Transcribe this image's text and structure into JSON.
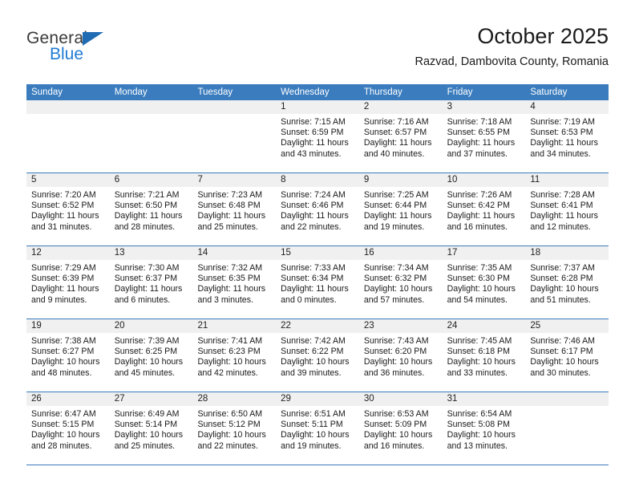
{
  "branding": {
    "name_top": "General",
    "name_bottom": "Blue",
    "accent_color": "#1f7bd4",
    "header_color": "#3a7cbe"
  },
  "header": {
    "title": "October 2025",
    "subtitle": "Razvad, Dambovita County, Romania"
  },
  "calendar": {
    "weekday_headers": [
      "Sunday",
      "Monday",
      "Tuesday",
      "Wednesday",
      "Thursday",
      "Friday",
      "Saturday"
    ],
    "weeks": [
      [
        {
          "day": "",
          "empty": true
        },
        {
          "day": "",
          "empty": true
        },
        {
          "day": "",
          "empty": true
        },
        {
          "day": "1",
          "sunrise": "Sunrise: 7:15 AM",
          "sunset": "Sunset: 6:59 PM",
          "daylight_l1": "Daylight: 11 hours",
          "daylight_l2": "and 43 minutes."
        },
        {
          "day": "2",
          "sunrise": "Sunrise: 7:16 AM",
          "sunset": "Sunset: 6:57 PM",
          "daylight_l1": "Daylight: 11 hours",
          "daylight_l2": "and 40 minutes."
        },
        {
          "day": "3",
          "sunrise": "Sunrise: 7:18 AM",
          "sunset": "Sunset: 6:55 PM",
          "daylight_l1": "Daylight: 11 hours",
          "daylight_l2": "and 37 minutes."
        },
        {
          "day": "4",
          "sunrise": "Sunrise: 7:19 AM",
          "sunset": "Sunset: 6:53 PM",
          "daylight_l1": "Daylight: 11 hours",
          "daylight_l2": "and 34 minutes."
        }
      ],
      [
        {
          "day": "5",
          "sunrise": "Sunrise: 7:20 AM",
          "sunset": "Sunset: 6:52 PM",
          "daylight_l1": "Daylight: 11 hours",
          "daylight_l2": "and 31 minutes."
        },
        {
          "day": "6",
          "sunrise": "Sunrise: 7:21 AM",
          "sunset": "Sunset: 6:50 PM",
          "daylight_l1": "Daylight: 11 hours",
          "daylight_l2": "and 28 minutes."
        },
        {
          "day": "7",
          "sunrise": "Sunrise: 7:23 AM",
          "sunset": "Sunset: 6:48 PM",
          "daylight_l1": "Daylight: 11 hours",
          "daylight_l2": "and 25 minutes."
        },
        {
          "day": "8",
          "sunrise": "Sunrise: 7:24 AM",
          "sunset": "Sunset: 6:46 PM",
          "daylight_l1": "Daylight: 11 hours",
          "daylight_l2": "and 22 minutes."
        },
        {
          "day": "9",
          "sunrise": "Sunrise: 7:25 AM",
          "sunset": "Sunset: 6:44 PM",
          "daylight_l1": "Daylight: 11 hours",
          "daylight_l2": "and 19 minutes."
        },
        {
          "day": "10",
          "sunrise": "Sunrise: 7:26 AM",
          "sunset": "Sunset: 6:42 PM",
          "daylight_l1": "Daylight: 11 hours",
          "daylight_l2": "and 16 minutes."
        },
        {
          "day": "11",
          "sunrise": "Sunrise: 7:28 AM",
          "sunset": "Sunset: 6:41 PM",
          "daylight_l1": "Daylight: 11 hours",
          "daylight_l2": "and 12 minutes."
        }
      ],
      [
        {
          "day": "12",
          "sunrise": "Sunrise: 7:29 AM",
          "sunset": "Sunset: 6:39 PM",
          "daylight_l1": "Daylight: 11 hours",
          "daylight_l2": "and 9 minutes."
        },
        {
          "day": "13",
          "sunrise": "Sunrise: 7:30 AM",
          "sunset": "Sunset: 6:37 PM",
          "daylight_l1": "Daylight: 11 hours",
          "daylight_l2": "and 6 minutes."
        },
        {
          "day": "14",
          "sunrise": "Sunrise: 7:32 AM",
          "sunset": "Sunset: 6:35 PM",
          "daylight_l1": "Daylight: 11 hours",
          "daylight_l2": "and 3 minutes."
        },
        {
          "day": "15",
          "sunrise": "Sunrise: 7:33 AM",
          "sunset": "Sunset: 6:34 PM",
          "daylight_l1": "Daylight: 11 hours",
          "daylight_l2": "and 0 minutes."
        },
        {
          "day": "16",
          "sunrise": "Sunrise: 7:34 AM",
          "sunset": "Sunset: 6:32 PM",
          "daylight_l1": "Daylight: 10 hours",
          "daylight_l2": "and 57 minutes."
        },
        {
          "day": "17",
          "sunrise": "Sunrise: 7:35 AM",
          "sunset": "Sunset: 6:30 PM",
          "daylight_l1": "Daylight: 10 hours",
          "daylight_l2": "and 54 minutes."
        },
        {
          "day": "18",
          "sunrise": "Sunrise: 7:37 AM",
          "sunset": "Sunset: 6:28 PM",
          "daylight_l1": "Daylight: 10 hours",
          "daylight_l2": "and 51 minutes."
        }
      ],
      [
        {
          "day": "19",
          "sunrise": "Sunrise: 7:38 AM",
          "sunset": "Sunset: 6:27 PM",
          "daylight_l1": "Daylight: 10 hours",
          "daylight_l2": "and 48 minutes."
        },
        {
          "day": "20",
          "sunrise": "Sunrise: 7:39 AM",
          "sunset": "Sunset: 6:25 PM",
          "daylight_l1": "Daylight: 10 hours",
          "daylight_l2": "and 45 minutes."
        },
        {
          "day": "21",
          "sunrise": "Sunrise: 7:41 AM",
          "sunset": "Sunset: 6:23 PM",
          "daylight_l1": "Daylight: 10 hours",
          "daylight_l2": "and 42 minutes."
        },
        {
          "day": "22",
          "sunrise": "Sunrise: 7:42 AM",
          "sunset": "Sunset: 6:22 PM",
          "daylight_l1": "Daylight: 10 hours",
          "daylight_l2": "and 39 minutes."
        },
        {
          "day": "23",
          "sunrise": "Sunrise: 7:43 AM",
          "sunset": "Sunset: 6:20 PM",
          "daylight_l1": "Daylight: 10 hours",
          "daylight_l2": "and 36 minutes."
        },
        {
          "day": "24",
          "sunrise": "Sunrise: 7:45 AM",
          "sunset": "Sunset: 6:18 PM",
          "daylight_l1": "Daylight: 10 hours",
          "daylight_l2": "and 33 minutes."
        },
        {
          "day": "25",
          "sunrise": "Sunrise: 7:46 AM",
          "sunset": "Sunset: 6:17 PM",
          "daylight_l1": "Daylight: 10 hours",
          "daylight_l2": "and 30 minutes."
        }
      ],
      [
        {
          "day": "26",
          "sunrise": "Sunrise: 6:47 AM",
          "sunset": "Sunset: 5:15 PM",
          "daylight_l1": "Daylight: 10 hours",
          "daylight_l2": "and 28 minutes."
        },
        {
          "day": "27",
          "sunrise": "Sunrise: 6:49 AM",
          "sunset": "Sunset: 5:14 PM",
          "daylight_l1": "Daylight: 10 hours",
          "daylight_l2": "and 25 minutes."
        },
        {
          "day": "28",
          "sunrise": "Sunrise: 6:50 AM",
          "sunset": "Sunset: 5:12 PM",
          "daylight_l1": "Daylight: 10 hours",
          "daylight_l2": "and 22 minutes."
        },
        {
          "day": "29",
          "sunrise": "Sunrise: 6:51 AM",
          "sunset": "Sunset: 5:11 PM",
          "daylight_l1": "Daylight: 10 hours",
          "daylight_l2": "and 19 minutes."
        },
        {
          "day": "30",
          "sunrise": "Sunrise: 6:53 AM",
          "sunset": "Sunset: 5:09 PM",
          "daylight_l1": "Daylight: 10 hours",
          "daylight_l2": "and 16 minutes."
        },
        {
          "day": "31",
          "sunrise": "Sunrise: 6:54 AM",
          "sunset": "Sunset: 5:08 PM",
          "daylight_l1": "Daylight: 10 hours",
          "daylight_l2": "and 13 minutes."
        },
        {
          "day": "",
          "empty": true
        }
      ]
    ]
  }
}
